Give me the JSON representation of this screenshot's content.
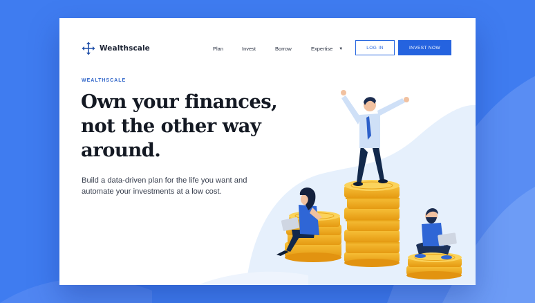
{
  "brand": {
    "name": "Wealthscale"
  },
  "nav": {
    "items": [
      "Plan",
      "Invest",
      "Borrow"
    ],
    "expertise": "Expertise"
  },
  "buttons": {
    "login": "LOG IN",
    "invest_now": "INVEST NOW"
  },
  "hero": {
    "eyebrow": "WEALTHSCALE",
    "headline": "Own your finances, not the other way around.",
    "subtext": "Build a data-driven plan for the life you want and automate your investments at a low cost."
  },
  "colors": {
    "page_background": "#3f7cf0",
    "brand_blue": "#2563df",
    "coin_gold": "#f6b521",
    "heading_text": "#141923"
  },
  "icons": [
    "arrows-move-icon",
    "caret-down-icon"
  ]
}
